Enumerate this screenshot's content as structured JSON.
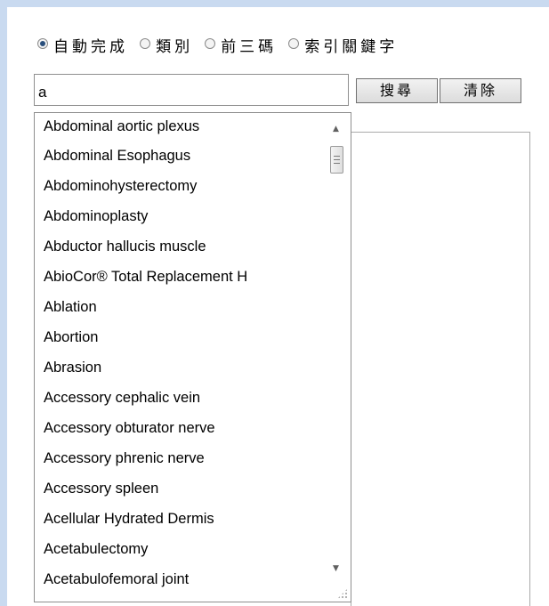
{
  "search_modes": [
    {
      "label": "自動完成",
      "selected": true
    },
    {
      "label": "類別",
      "selected": false
    },
    {
      "label": "前三碼",
      "selected": false
    },
    {
      "label": "索引關鍵字",
      "selected": false
    }
  ],
  "search": {
    "value": "a",
    "search_button": "搜尋",
    "clear_button": "清除"
  },
  "suggestions": [
    "Abdominal aortic plexus",
    "Abdominal Esophagus",
    "Abdominohysterectomy",
    "Abdominoplasty",
    "Abductor hallucis muscle",
    "AbioCor® Total Replacement H",
    "Ablation",
    "Abortion",
    "Abrasion",
    "Accessory cephalic vein",
    "Accessory obturator nerve",
    "Accessory phrenic nerve",
    "Accessory spleen",
    "Acellular Hydrated Dermis",
    "Acetabulectomy",
    "Acetabulofemoral joint"
  ],
  "colors": {
    "window_frame": "#c9daf0",
    "radio_selected": "#2a4f7c"
  }
}
